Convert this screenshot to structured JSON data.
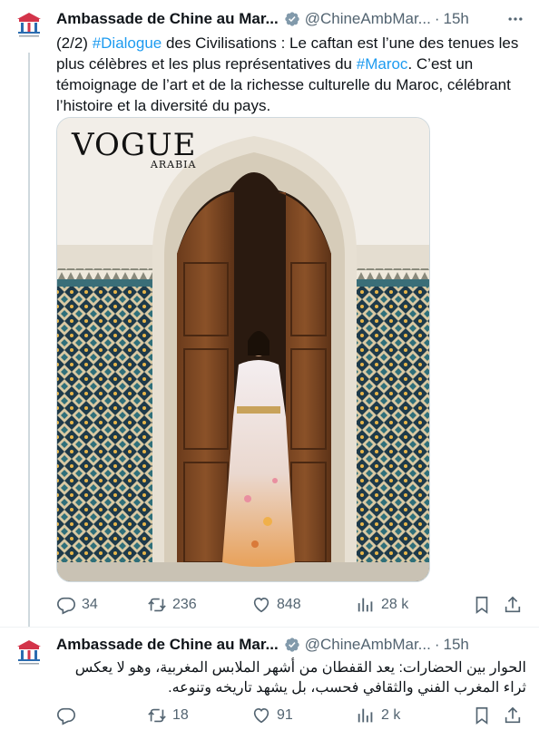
{
  "tweets": [
    {
      "author_name": "Ambassade de Chine au Mar...",
      "handle": "@ChineAmbMar...",
      "separator": "·",
      "time": "15h",
      "text_prefix": "(2/2) ",
      "hashtag1": "#Dialogue",
      "text_mid": " des Civilisations : Le caftan est l’une des tenues les plus célèbres et les plus représentatives du ",
      "hashtag2": "#Maroc",
      "text_suffix": ". C’est un témoignage de l’art et de la richesse culturelle du Maroc, célébrant l’histoire et la diversité du pays.",
      "media": {
        "logo_main": "VOGUE",
        "logo_sub": "ARABIA"
      },
      "actions": {
        "replies": "34",
        "reposts": "236",
        "likes": "848",
        "views": "28 k"
      }
    },
    {
      "author_name": "Ambassade de Chine au Mar...",
      "handle": "@ChineAmbMar...",
      "separator": "·",
      "time": "15h",
      "text": "الحوار بين الحضارات: يعد القفطان من أشهر الملابس المغربية، وهو لا يعكس ثراء المغرب الفني والثقافي فحسب، بل يشهد تاريخه وتنوعه.",
      "actions": {
        "replies": "",
        "reposts": "18",
        "likes": "91",
        "views": "2 k"
      }
    }
  ],
  "colors": {
    "accent": "#1d9bf0",
    "muted": "#536471",
    "text": "#0f1419",
    "verified": "#829aab"
  },
  "icons": [
    "embassy-logo-icon",
    "verified-badge-icon",
    "more-icon",
    "reply-icon",
    "repost-icon",
    "like-icon",
    "views-icon",
    "bookmark-icon",
    "share-icon"
  ]
}
